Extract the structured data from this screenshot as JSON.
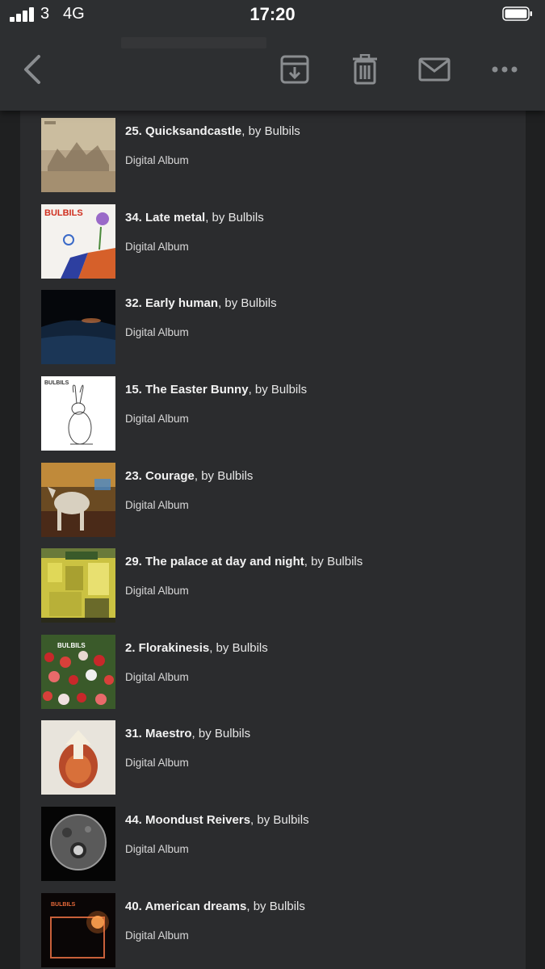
{
  "status_bar": {
    "carrier": "3",
    "network": "4G",
    "time": "17:20"
  },
  "toolbar": {
    "buttons": [
      "back-icon",
      "archive-icon",
      "trash-icon",
      "mail-icon",
      "more-icon"
    ]
  },
  "items": [
    {
      "title": "25. Quicksandcastle",
      "by": ", by Bulbils",
      "format": "Digital Album"
    },
    {
      "title": "34. Late metal",
      "by": ", by Bulbils",
      "format": "Digital Album"
    },
    {
      "title": "32. Early human",
      "by": ", by Bulbils",
      "format": "Digital Album"
    },
    {
      "title": "15. The Easter Bunny",
      "by": ", by Bulbils",
      "format": "Digital Album"
    },
    {
      "title": "23. Courage",
      "by": ", by Bulbils",
      "format": "Digital Album"
    },
    {
      "title": "29. The palace at day and night",
      "by": ", by Bulbils",
      "format": "Digital Album"
    },
    {
      "title": "2. Florakinesis",
      "by": ", by Bulbils",
      "format": "Digital Album"
    },
    {
      "title": "31. Maestro",
      "by": ", by Bulbils",
      "format": "Digital Album"
    },
    {
      "title": "44. Moondust Reivers",
      "by": ", by Bulbils",
      "format": "Digital Album"
    },
    {
      "title": "40. American dreams",
      "by": ", by Bulbils",
      "format": "Digital Album"
    }
  ],
  "art_labels": {
    "bulbils": "BULBILS"
  }
}
